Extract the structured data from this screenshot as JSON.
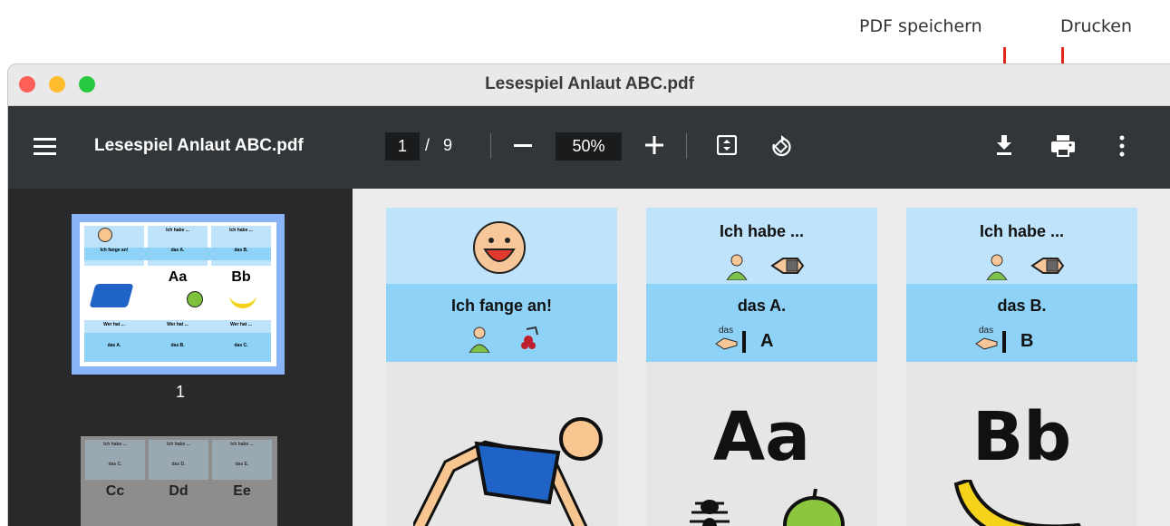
{
  "annotations": {
    "save": "PDF speichern",
    "print": "Drucken"
  },
  "window": {
    "title": "Lesespiel Anlaut ABC.pdf"
  },
  "toolbar": {
    "doc_title": "Lesespiel Anlaut ABC.pdf",
    "current_page": "1",
    "page_sep": "/",
    "total_pages": "9",
    "zoom": "50%"
  },
  "sidebar": {
    "page1_label": "1",
    "thumb1": {
      "c1": "Ich fange an!",
      "c2a": "Ich habe ...",
      "c2b": "das A.",
      "c3a": "Ich habe ...",
      "c3b": "das B.",
      "l1": "Aa",
      "l2": "Bb",
      "w1": "Wer hat ...",
      "w2": "Wer hat ...",
      "w3": "Wer hat ...",
      "d1": "das A.",
      "d2": "das B.",
      "d3": "das C."
    },
    "thumb2": {
      "h1": "Ich habe ...",
      "h2": "Ich habe ...",
      "h3": "Ich habe ...",
      "d1": "das C.",
      "d2": "das D.",
      "d3": "das E.",
      "l1": "Cc",
      "l2": "Dd",
      "l3": "Ee"
    }
  },
  "cards": [
    {
      "top_text": "",
      "mid_text": "Ich fange an!",
      "letter": ""
    },
    {
      "top_text": "Ich habe ...",
      "mid_text": "das A.",
      "small": "das",
      "mark": "A",
      "letter": "Aa"
    },
    {
      "top_text": "Ich habe ...",
      "mid_text": "das B.",
      "small": "das",
      "mark": "B",
      "letter": "Bb"
    }
  ]
}
